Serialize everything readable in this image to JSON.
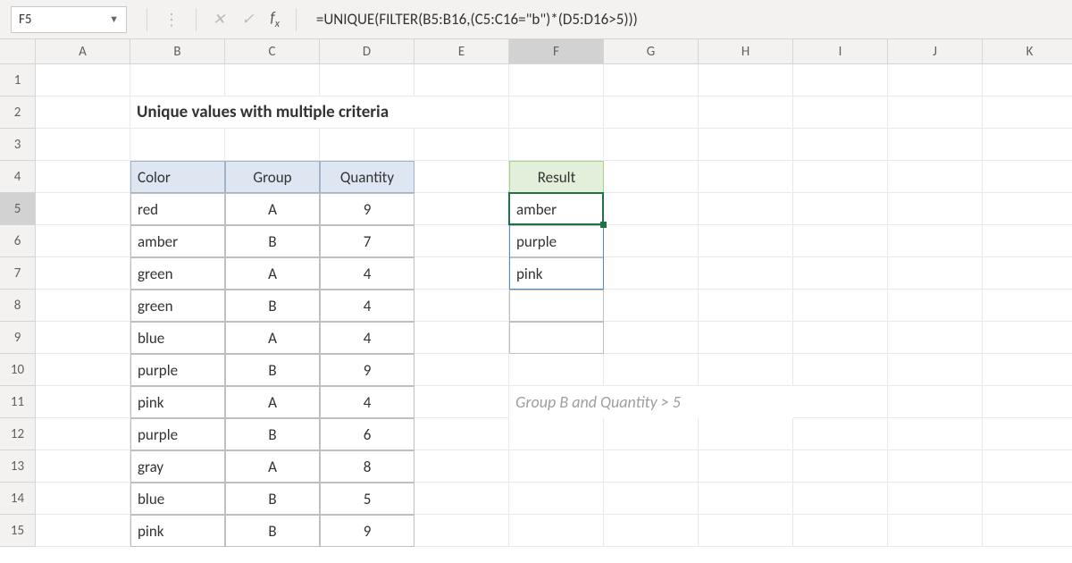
{
  "active_cell": "F5",
  "formula": "=UNIQUE(FILTER(B5:B16,(C5:C16=\"b\")*(D5:D16>5)))",
  "columns": [
    "A",
    "B",
    "C",
    "D",
    "E",
    "F",
    "G",
    "H",
    "I",
    "J",
    "K"
  ],
  "rows": [
    "1",
    "2",
    "3",
    "4",
    "5",
    "6",
    "7",
    "8",
    "9",
    "10",
    "11",
    "12",
    "13",
    "14",
    "15"
  ],
  "title": "Unique values with multiple criteria",
  "table": {
    "headers": {
      "color": "Color",
      "group": "Group",
      "qty": "Quantity"
    },
    "rows": [
      {
        "color": "red",
        "group": "A",
        "qty": "9"
      },
      {
        "color": "amber",
        "group": "B",
        "qty": "7"
      },
      {
        "color": "green",
        "group": "A",
        "qty": "4"
      },
      {
        "color": "green",
        "group": "B",
        "qty": "4"
      },
      {
        "color": "blue",
        "group": "A",
        "qty": "4"
      },
      {
        "color": "purple",
        "group": "B",
        "qty": "9"
      },
      {
        "color": "pink",
        "group": "A",
        "qty": "4"
      },
      {
        "color": "purple",
        "group": "B",
        "qty": "6"
      },
      {
        "color": "gray",
        "group": "A",
        "qty": "8"
      },
      {
        "color": "blue",
        "group": "B",
        "qty": "5"
      },
      {
        "color": "pink",
        "group": "B",
        "qty": "9"
      }
    ]
  },
  "result": {
    "header": "Result",
    "values": [
      "amber",
      "purple",
      "pink",
      "",
      ""
    ]
  },
  "caption": "Group B and Quantity > 5"
}
